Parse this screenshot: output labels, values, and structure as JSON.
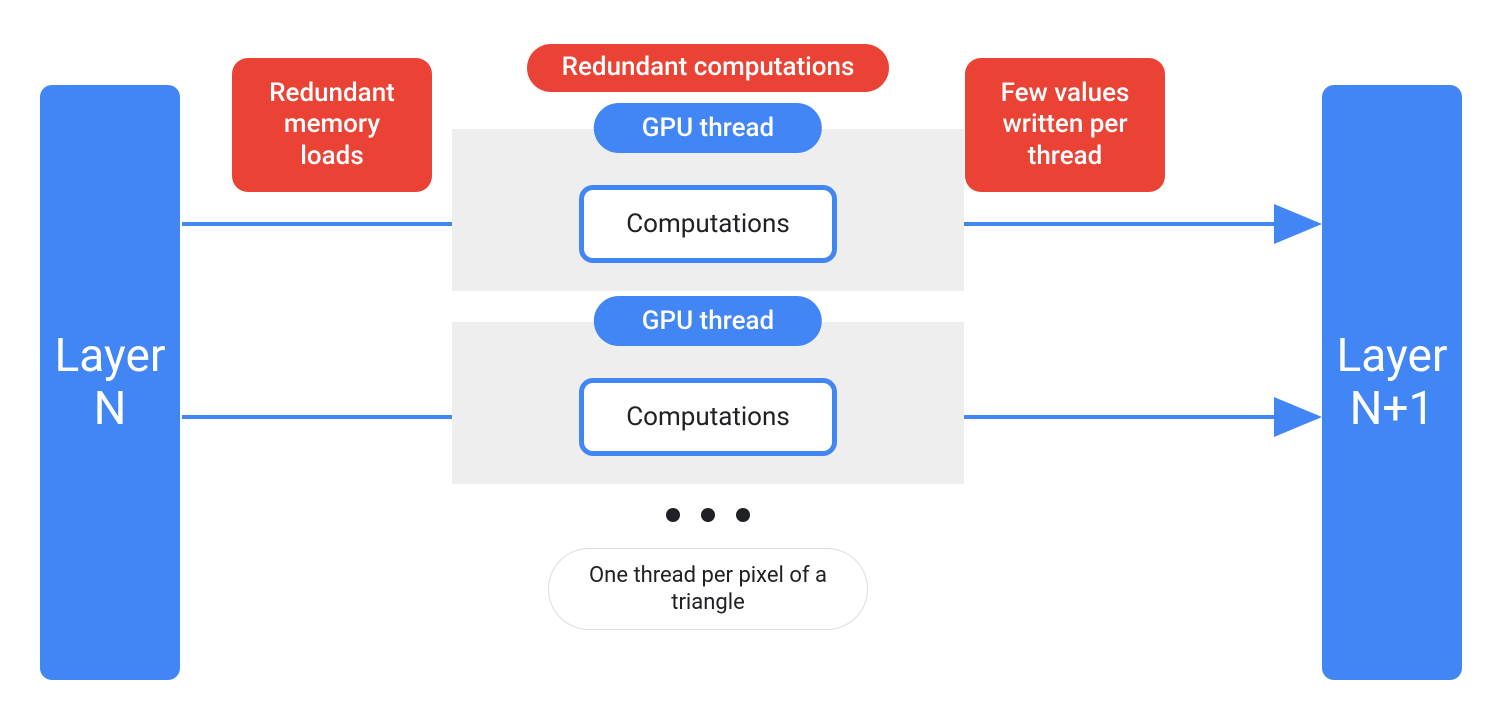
{
  "layers": {
    "left_label": "Layer\nN",
    "right_label": "Layer\nN+1"
  },
  "callouts": {
    "memory_loads": "Redundant memory loads",
    "redundant_computations": "Redundant computations",
    "few_values": "Few values written per thread"
  },
  "threads": {
    "gpu_thread_label": "GPU thread",
    "computations_label": "Computations"
  },
  "footer": {
    "per_pixel_label": "One thread per pixel of a triangle"
  },
  "colors": {
    "blue": "#4285F4",
    "red": "#EA4335",
    "grey": "#eeeeee"
  }
}
